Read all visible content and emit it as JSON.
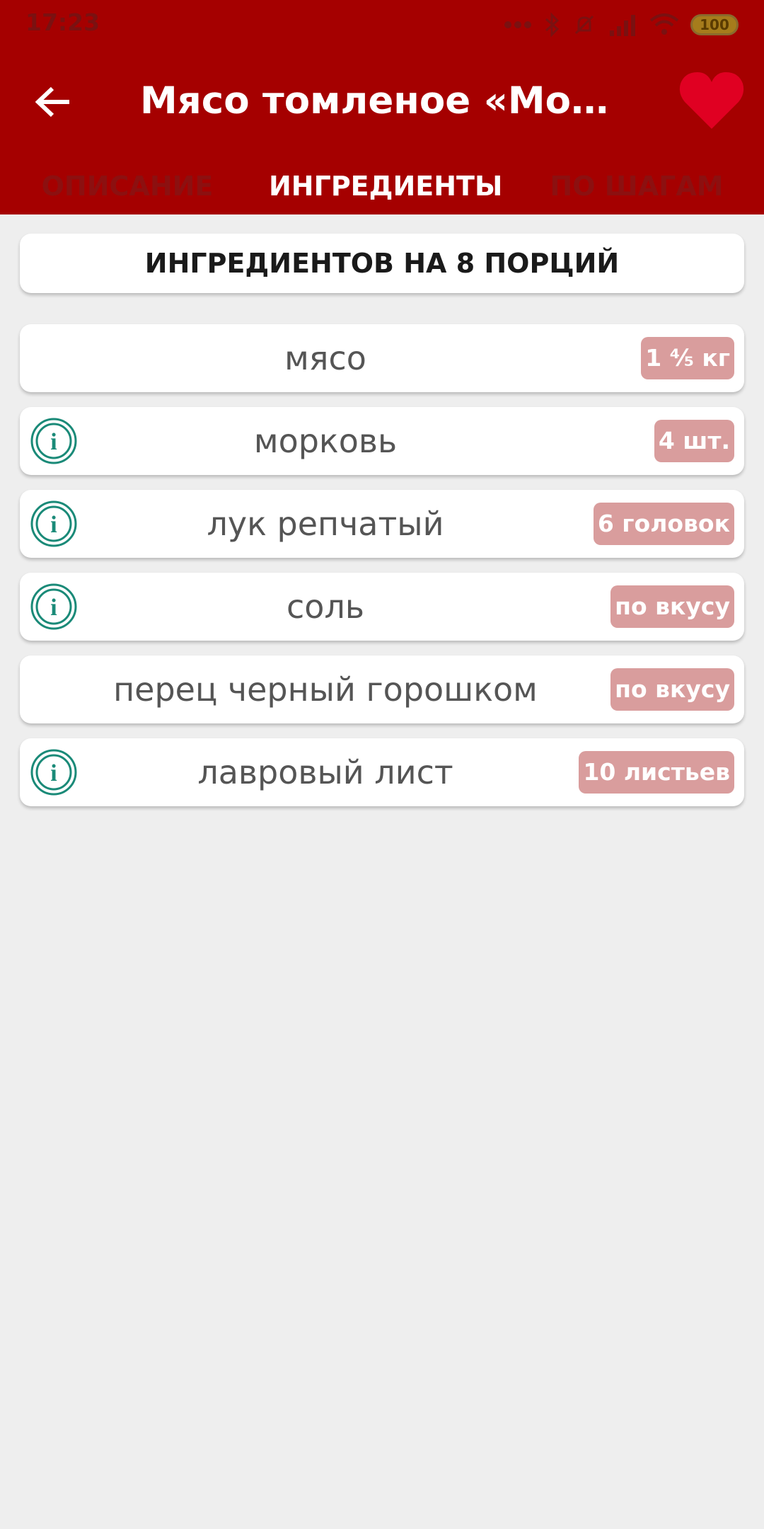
{
  "status_bar": {
    "time": "17:23",
    "battery": "100"
  },
  "toolbar": {
    "title": "Мясо томленое «Морозн…"
  },
  "tabs": [
    {
      "label": "ОПИСАНИЕ",
      "active": false
    },
    {
      "label": "ИНГРЕДИЕНТЫ",
      "active": true
    },
    {
      "label": "ПО ШАГАМ",
      "active": false
    }
  ],
  "portions": {
    "label": "ИНГРЕДИЕНТОВ НА 8 ПОРЦИЙ"
  },
  "ingredients": [
    {
      "name": "мясо",
      "amount": "1 ⅘ кг",
      "has_info": false
    },
    {
      "name": "морковь",
      "amount": "4 шт.",
      "has_info": true
    },
    {
      "name": "лук репчатый",
      "amount": "6 головок",
      "has_info": true
    },
    {
      "name": "соль",
      "amount": "по вкусу",
      "has_info": true
    },
    {
      "name": "перец черный горошком",
      "amount": "по вкусу",
      "has_info": false
    },
    {
      "name": "лавровый лист",
      "amount": "10 листьев",
      "has_info": true
    }
  ],
  "colors": {
    "app_bar": "#a50000",
    "heart": "#e00022",
    "amount_badge": "#d99d9d",
    "info_icon": "#1a8a78",
    "background": "#eeeeee"
  },
  "icons": {
    "back": "arrow-left-icon",
    "favorite": "heart-icon",
    "info": "info-icon"
  }
}
